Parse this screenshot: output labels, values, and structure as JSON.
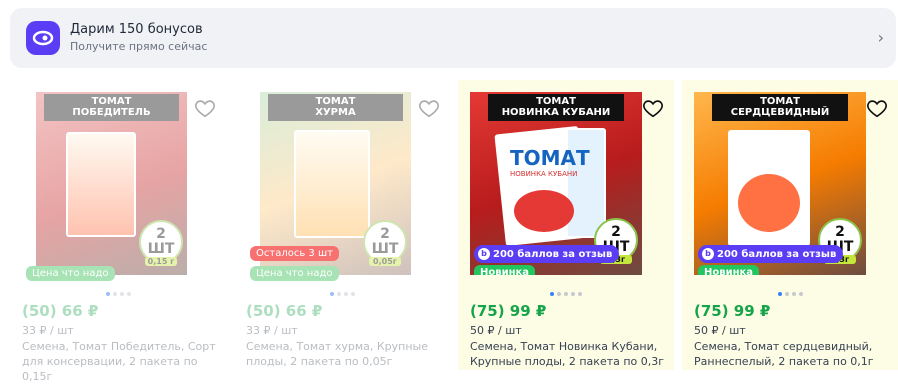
{
  "banner": {
    "title": "Дарим 150 бонусов",
    "subtitle": "Получите прямо сейчас",
    "accent": "#5b3df5"
  },
  "products": [
    {
      "title_line1": "ТОМАТ",
      "title_line2": "ПОБЕДИТЕЛЬ",
      "pcs_count": "2 ШТ",
      "pcs_per": "ПО",
      "pcs_weight": "0,15 г",
      "tag": "Цена что надо",
      "price": "(50) 66 ₽",
      "unit_price": "33 ₽ / шт",
      "description": "Семена, Томат Победитель, Сорт для консервации, 2 пакета по 0,15г",
      "carousel": {
        "total": 4,
        "active": 0
      }
    },
    {
      "title_line1": "ТОМАТ",
      "title_line2": "ХУРМА",
      "pcs_count": "2 ШТ",
      "pcs_per": "ПО",
      "pcs_weight": "0,05г",
      "tag_top": "Осталось 3 шт",
      "tag": "Цена что надо",
      "price": "(50) 66 ₽",
      "unit_price": "33 ₽ / шт",
      "description": "Семена, Томат хурма, Крупные плоды, 2 пакета по 0,05г",
      "carousel": {
        "total": 4,
        "active": 0
      }
    },
    {
      "title_line1": "ТОМАТ",
      "title_line2": "НОВИНКА КУБАНИ",
      "packet_text": "ТОМАТ",
      "packet_sub": "НОВИНКА КУБАНИ",
      "pcs_count": "2 ШТ",
      "pcs_per": "ПО",
      "pcs_weight": "0,3г",
      "bonus_tag": "200 баллов за отзыв",
      "tag": "Новинка",
      "price": "(75) 99 ₽",
      "unit_price": "50 ₽ / шт",
      "description": "Семена, Томат Новинка Кубани, Крупные плоды, 2 пакета по 0,3г",
      "carousel": {
        "total": 5,
        "active": 0
      }
    },
    {
      "title_line1": "ТОМАТ",
      "title_line2": "СЕРДЦЕВИДНЫЙ",
      "pcs_count": "2 ШТ",
      "pcs_per": "ПО",
      "pcs_weight": "0,3г",
      "bonus_tag": "200 баллов за отзыв",
      "tag": "Новинка",
      "price": "(75) 99 ₽",
      "unit_price": "50 ₽ / шт",
      "description": "Семена, Томат сердцевидный, Раннеспелый, 2 пакета по 0,1г",
      "carousel": {
        "total": 4,
        "active": 0
      }
    }
  ],
  "colors": {
    "price_green": "#16a34a",
    "highlight_bg": "#fdfde6",
    "new_tag": "#22c55e"
  }
}
